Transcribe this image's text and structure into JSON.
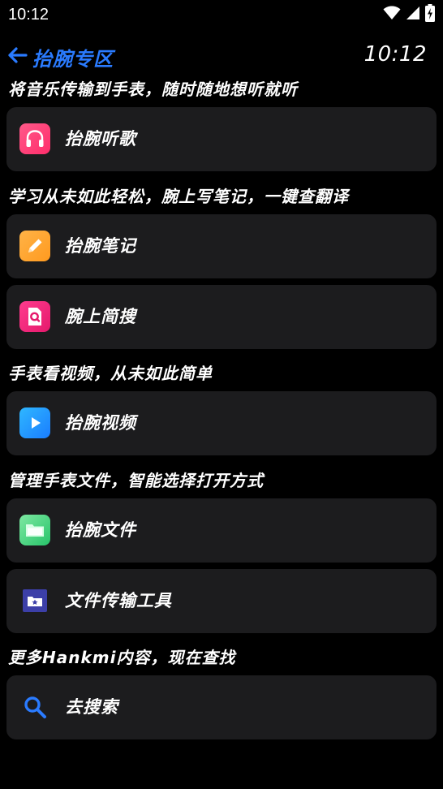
{
  "status_bar": {
    "time": "10:12",
    "icons": [
      "wifi-icon",
      "signal-icon",
      "battery-charging-icon"
    ]
  },
  "header": {
    "back_icon": "arrow-left-icon",
    "title": "抬腕专区",
    "clock": "10:12"
  },
  "colors": {
    "accent": "#2a7bff",
    "card_bg": "#1c1c1e",
    "background": "#000000"
  },
  "sections": [
    {
      "title": "将音乐传输到手表，随时随地想听就听",
      "items": [
        {
          "label": "抬腕听歌",
          "icon": "headphones-icon"
        }
      ]
    },
    {
      "title": "学习从未如此轻松，腕上写笔记，一键查翻译",
      "items": [
        {
          "label": "抬腕笔记",
          "icon": "pencil-icon"
        },
        {
          "label": "腕上简搜",
          "icon": "search-doc-icon"
        }
      ]
    },
    {
      "title": "手表看视频，从未如此简单",
      "items": [
        {
          "label": "抬腕视频",
          "icon": "play-icon"
        }
      ]
    },
    {
      "title": "管理手表文件，智能选择打开方式",
      "items": [
        {
          "label": "抬腕文件",
          "icon": "folder-icon"
        },
        {
          "label": "文件传输工具",
          "icon": "folder-star-icon"
        }
      ]
    },
    {
      "title": "更多Hankmi内容，现在查找",
      "items": [
        {
          "label": "去搜索",
          "icon": "search-icon"
        }
      ]
    }
  ]
}
